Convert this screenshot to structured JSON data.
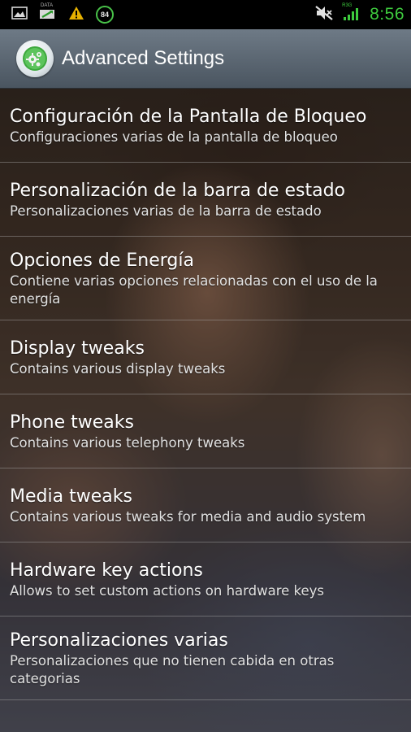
{
  "status_bar": {
    "time": "8:56",
    "battery_level": "84",
    "data_label": "DATA",
    "network_label": "R3G",
    "icons": [
      "gallery-icon",
      "data-sync-icon",
      "warning-icon",
      "battery-badge-icon",
      "mute-icon",
      "signal-icon"
    ],
    "time_color": "#3ecb3e"
  },
  "action_bar": {
    "title": "Advanced Settings",
    "icon": "gears-icon"
  },
  "items": [
    {
      "title": "Configuración de la Pantalla de Bloqueo",
      "summary": "Configuraciones varias de la pantalla de bloqueo"
    },
    {
      "title": "Personalización de la barra de estado",
      "summary": "Personalizaciones varias de la barra de estado"
    },
    {
      "title": "Opciones de Energía",
      "summary": "Contiene varias opciones relacionadas con el uso de la energía"
    },
    {
      "title": "Display tweaks",
      "summary": "Contains various display tweaks"
    },
    {
      "title": "Phone tweaks",
      "summary": "Contains various telephony tweaks"
    },
    {
      "title": "Media tweaks",
      "summary": "Contains various tweaks for media and audio system"
    },
    {
      "title": "Hardware key actions",
      "summary": "Allows to set custom actions on hardware keys"
    },
    {
      "title": "Personalizaciones varias",
      "summary": "Personalizaciones que no tienen cabida en otras categorias"
    }
  ]
}
